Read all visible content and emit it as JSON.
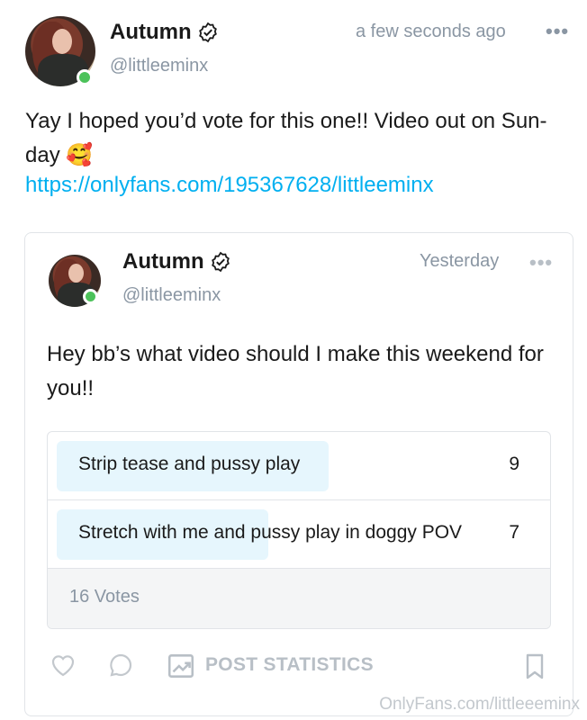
{
  "post": {
    "author_name": "Autumn",
    "author_handle": "@littleeminx",
    "timestamp": "a few seconds ago",
    "more_glyph": "•••",
    "text": "Yay I hoped you’d vote for this one!! Video out on Sun- day 🥰",
    "link": "https://onlyfans.com/195367628/littleeminx"
  },
  "quoted_post": {
    "author_name": "Autumn",
    "author_handle": "@littleeminx",
    "timestamp": "Yesterday",
    "more_glyph": "•••",
    "text": "Hey bb’s what video should I make this weekend for you!!",
    "poll": {
      "options": [
        {
          "label": "Strip tease and pussy play",
          "count": "9",
          "votes": 9
        },
        {
          "label": "Stretch with me and pussy play in doggy POV",
          "count": "7",
          "votes": 7
        }
      ],
      "total_votes": "16 Votes"
    },
    "actions": {
      "post_statistics_label": "POST STATISTICS"
    }
  },
  "watermark": "OnlyFans.com/littleeeminx",
  "colors": {
    "accent": "#00aff0",
    "muted": "#8a96a3",
    "online": "#4cc25a",
    "poll_fill": "#e6f6fd"
  },
  "icons": [
    "verified-check-icon",
    "more-options-icon",
    "heart-icon",
    "comment-icon",
    "statistics-icon",
    "bookmark-icon"
  ]
}
